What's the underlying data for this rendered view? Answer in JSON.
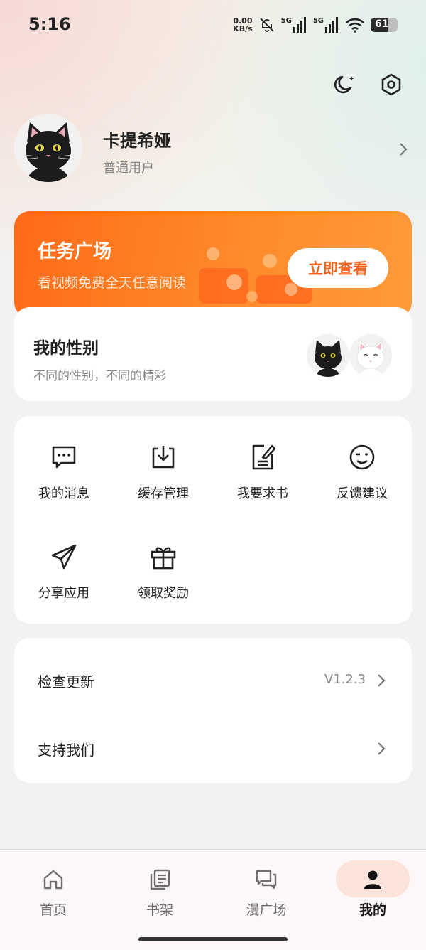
{
  "status_bar": {
    "time": "5:16",
    "net_speed_value": "0.00",
    "net_speed_unit": "KB/s",
    "sim1": "5G",
    "sim2": "5G",
    "battery": "61"
  },
  "header": {
    "theme_icon": "moon-icon",
    "settings_icon": "gear-icon"
  },
  "profile": {
    "name": "卡提希娅",
    "role": "普通用户"
  },
  "task_banner": {
    "title": "任务广场",
    "subtitle": "看视频免费全天任意阅读",
    "button_label": "立即查看",
    "accent_color": "#ff6a18"
  },
  "gender": {
    "title": "我的性别",
    "subtitle": "不同的性别，不同的精彩"
  },
  "grid": {
    "items": [
      {
        "label": "我的消息",
        "icon": "message-icon"
      },
      {
        "label": "缓存管理",
        "icon": "download-icon"
      },
      {
        "label": "我要求书",
        "icon": "edit-note-icon"
      },
      {
        "label": "反馈建议",
        "icon": "smile-icon"
      },
      {
        "label": "分享应用",
        "icon": "send-icon"
      },
      {
        "label": "领取奖励",
        "icon": "gift-icon"
      }
    ]
  },
  "list": {
    "check_update": {
      "label": "检查更新",
      "value": "V1.2.3"
    },
    "support_us": {
      "label": "支持我们"
    }
  },
  "bottom_nav": {
    "items": [
      {
        "label": "首页",
        "icon": "home-icon"
      },
      {
        "label": "书架",
        "icon": "bookshelf-icon"
      },
      {
        "label": "漫广场",
        "icon": "chat-icon"
      },
      {
        "label": "我的",
        "icon": "person-icon"
      }
    ],
    "active": "我的"
  }
}
